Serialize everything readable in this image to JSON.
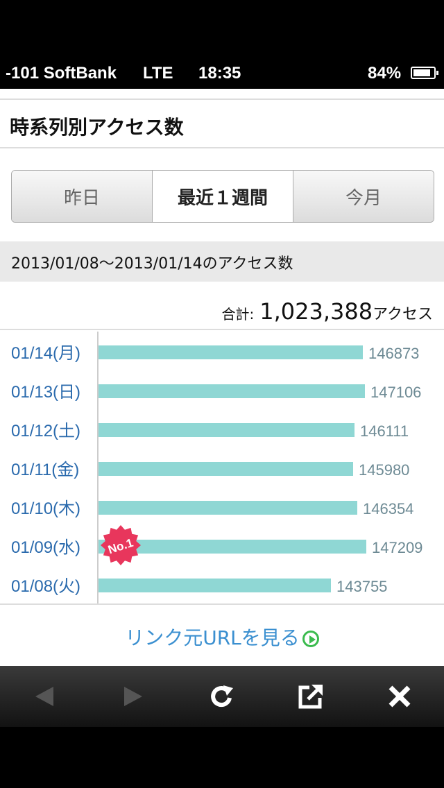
{
  "status_bar": {
    "carrier": "-101 SoftBank",
    "network": "LTE",
    "time": "18:35",
    "battery": "84%",
    "battery_level": 0.84
  },
  "page": {
    "title": "時系列別アクセス数"
  },
  "tabs": [
    {
      "label": "昨日",
      "active": false
    },
    {
      "label": "最近１週間",
      "active": true
    },
    {
      "label": "今月",
      "active": false
    }
  ],
  "range_label": "2013/01/08〜2013/01/14のアクセス数",
  "total": {
    "label": "合計:",
    "value": "1,023,388",
    "unit": "アクセス"
  },
  "chart_data": {
    "type": "bar",
    "orientation": "horizontal",
    "categories": [
      "01/14(月)",
      "01/13(日)",
      "01/12(土)",
      "01/11(金)",
      "01/10(木)",
      "01/09(水)",
      "01/08(火)"
    ],
    "values": [
      146873,
      147106,
      146111,
      145980,
      146354,
      147209,
      143755
    ],
    "rank_badge": {
      "category": "01/09(水)",
      "text": "No.1"
    },
    "bar_color": "#8fd7d4",
    "label_color": "#2a6aad",
    "value_color": "#6d8a94"
  },
  "link": {
    "label": "リンク元URLを見る"
  },
  "toolbar": {
    "icons": [
      "back-icon",
      "forward-icon",
      "reload-icon",
      "share-icon",
      "close-icon"
    ]
  }
}
